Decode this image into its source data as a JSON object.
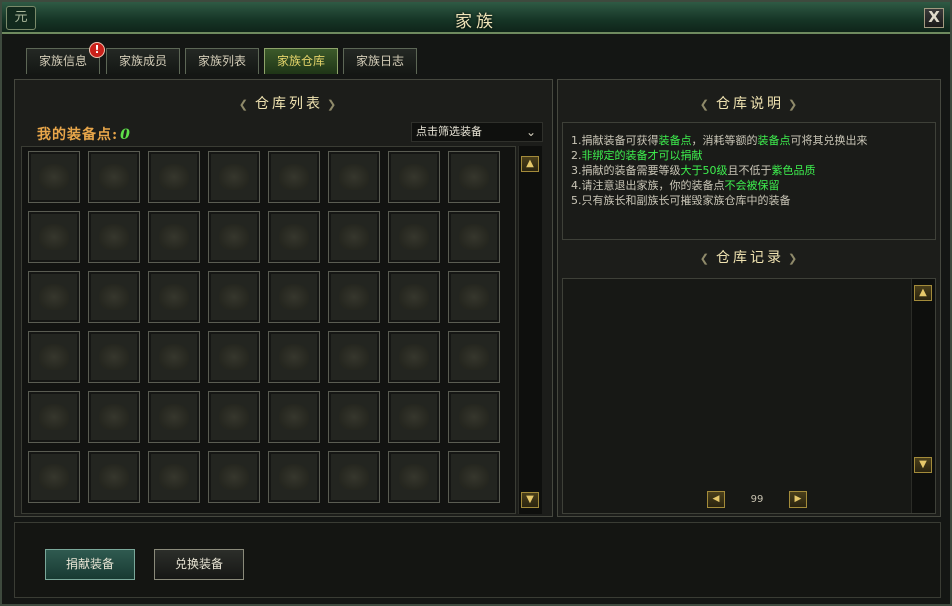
{
  "window": {
    "title": "家族",
    "corner_icon": "元",
    "close_label": "X"
  },
  "tabs": [
    {
      "label": "家族信息",
      "badge": "!"
    },
    {
      "label": "家族成员"
    },
    {
      "label": "家族列表"
    },
    {
      "label": "家族仓库",
      "active": true
    },
    {
      "label": "家族日志"
    }
  ],
  "left": {
    "heading": "仓库列表",
    "points_label": "我的装备点:",
    "points_value": "0",
    "filter": {
      "selected": "点击筛选装备",
      "icon": "chevron-down-icon"
    },
    "grid": {
      "rows": 6,
      "cols": 8
    }
  },
  "right": {
    "desc_heading": "仓库说明",
    "desc_lines": [
      {
        "parts": [
          {
            "t": "1.捐献装备可获得"
          },
          {
            "t": "装备点",
            "hl": true
          },
          {
            "t": "，消耗等额的"
          },
          {
            "t": "装备点",
            "hl": true
          },
          {
            "t": "可将其兑换出来"
          }
        ]
      },
      {
        "parts": [
          {
            "t": "2."
          },
          {
            "t": "非绑定的装备才可以捐献",
            "hl": true
          }
        ]
      },
      {
        "parts": [
          {
            "t": "3.捐献的装备需要等级"
          },
          {
            "t": "大于50级",
            "hl": true
          },
          {
            "t": "且不低于"
          },
          {
            "t": "紫色品质",
            "hl": true
          }
        ]
      },
      {
        "parts": [
          {
            "t": "4.请注意退出家族，你的装备点"
          },
          {
            "t": "不会被保留",
            "hl": true
          }
        ]
      },
      {
        "parts": [
          {
            "t": "5.只有族长和副族长可摧毁家族仓库中的装备"
          }
        ]
      }
    ],
    "log_heading": "仓库记录",
    "page": "99"
  },
  "buttons": {
    "donate": "捐献装备",
    "exchange": "兑换装备"
  },
  "colors": {
    "highlight": "#3ef04e",
    "points_label": "#e8a64a",
    "active_tab": "#e4d46a"
  }
}
